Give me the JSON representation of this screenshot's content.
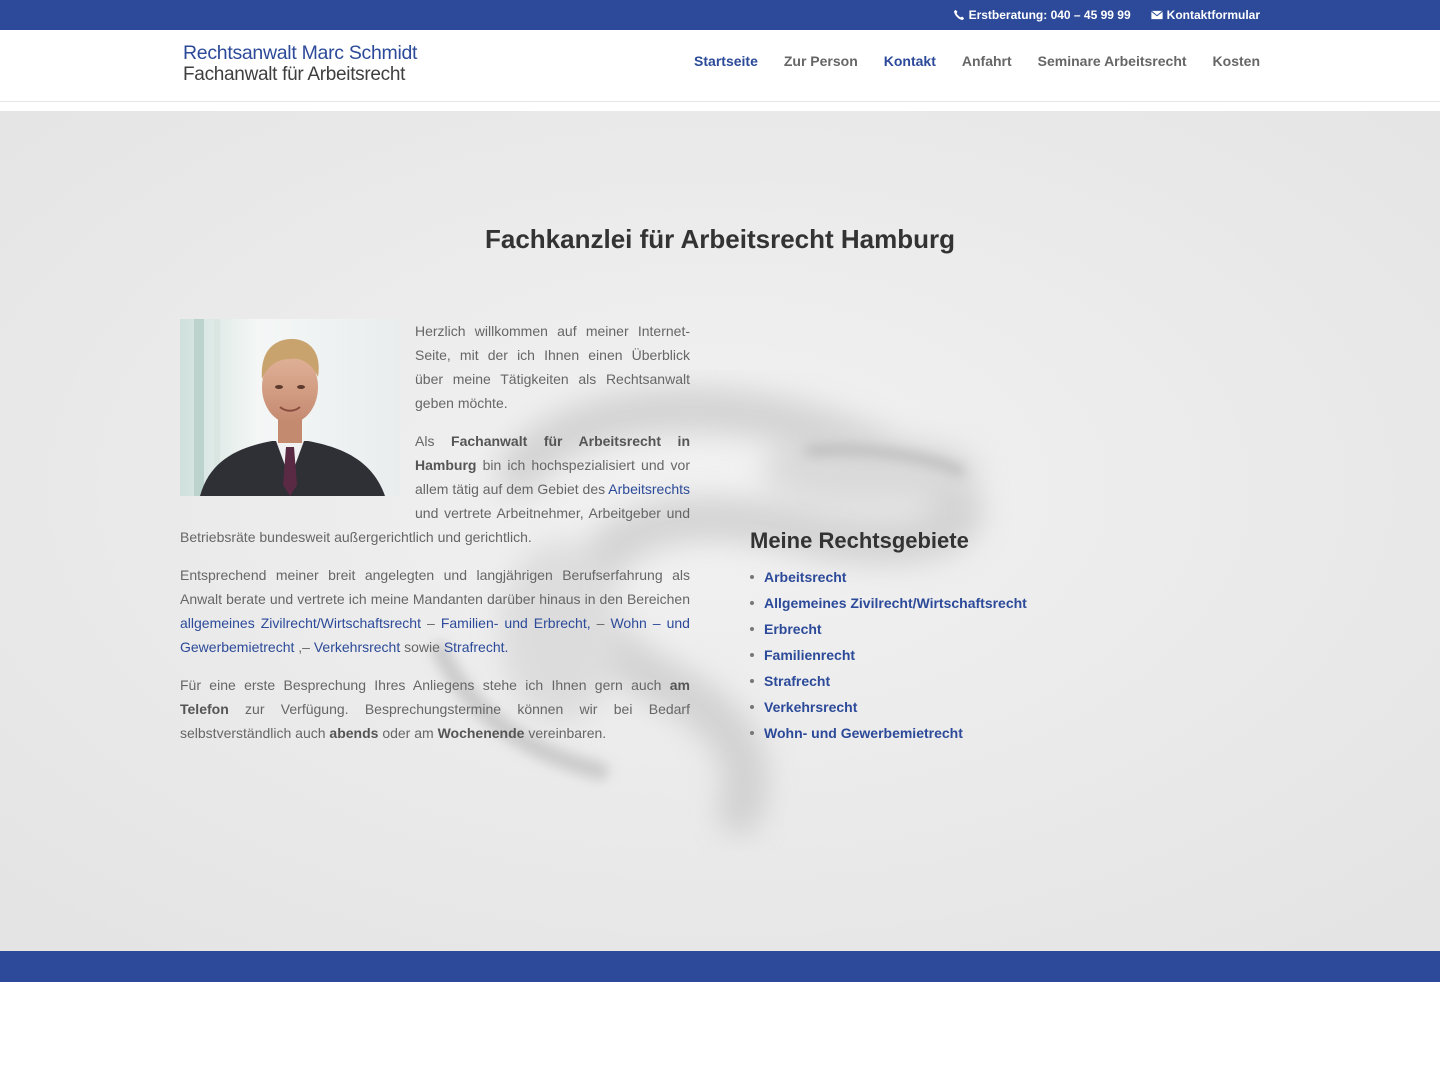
{
  "topbar": {
    "phone_label": "Erstberatung: 040 – 45 99 99",
    "contact_label": "Kontaktformular",
    "phone_icon": "phone-icon",
    "mail_icon": "mail-icon"
  },
  "logo": {
    "line1": "Rechtsanwalt Marc Schmidt",
    "line2": "Fachanwalt für Arbeitsrecht"
  },
  "nav": {
    "items": [
      {
        "label": "Startseite"
      },
      {
        "label": "Zur Person"
      },
      {
        "label": "Kontakt"
      },
      {
        "label": "Anfahrt"
      },
      {
        "label": "Seminare Arbeitsrecht"
      },
      {
        "label": "Kosten"
      }
    ]
  },
  "main": {
    "title": "Fachkanzlei für Arbeitsrecht Hamburg",
    "p1": "Herzlich willkommen auf meiner Internet-Seite, mit der ich Ihnen einen Überblick über meine Tätigkeiten als Rechtsanwalt geben möchte.",
    "p2": {
      "t1": "Als ",
      "b1": "Fachanwalt für Arbeitsrecht in Hamburg",
      "t2": " bin ich hochspezialisiert und vor allem tätig auf dem Gebiet des ",
      "link1": "Arbeitsrechts",
      "t3": " und vertrete Arbeitnehmer, Arbeitgeber und Betriebsräte bundesweit außergerichtlich und gerichtlich."
    },
    "p3": {
      "t1": "Entsprechend meiner breit angelegten und langjährigen Berufserfahrung als Anwalt berate und vertrete ich meine Mandanten darüber hinaus in den Bereichen ",
      "link1": "allgemeines Zivilrecht/Wirtschaftsrecht",
      "t2": " – ",
      "link2": "Familien- und Erbrecht,",
      "t3": " – ",
      "link3": "Wohn – und Gewerbemietrecht",
      "t4": " ,– ",
      "link4": "Verkehrsrecht",
      "t5": " sowie ",
      "link5": "Strafrecht."
    },
    "p4": {
      "t1": "Für eine erste Besprechung Ihres Anliegens stehe ich Ihnen gern auch ",
      "b1": "am Telefon",
      "t2": " zur Verfügung. Besprechungstermine können wir bei Bedarf selbstverständlich auch ",
      "b2": "abends",
      "t3": " oder am ",
      "b3": "Wochenende",
      "t4": " vereinbaren."
    }
  },
  "sidebar": {
    "title": "Meine Rechtsgebiete",
    "items": [
      {
        "label": "Arbeitsrecht"
      },
      {
        "label": "Allgemeines Zivilrecht/Wirtschaftsrecht"
      },
      {
        "label": "Erbrecht"
      },
      {
        "label": "Familienrecht"
      },
      {
        "label": "Strafrecht"
      },
      {
        "label": "Verkehrsrecht"
      },
      {
        "label": "Wohn- und Gewerbemietrecht"
      }
    ]
  },
  "colors": {
    "brand": "#2c4a99",
    "text": "#666666",
    "heading": "#333333"
  }
}
